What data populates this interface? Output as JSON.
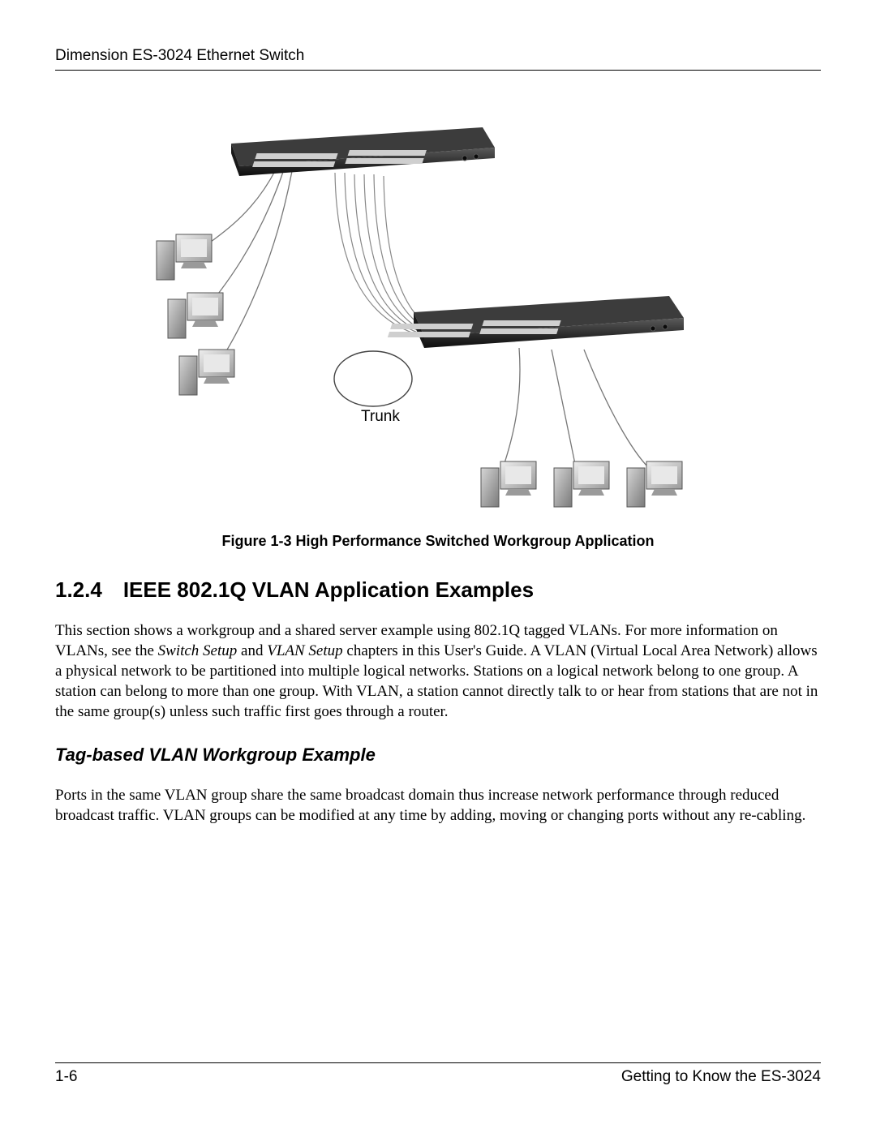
{
  "header": {
    "title": "Dimension ES-3024 Ethernet Switch"
  },
  "figure": {
    "trunk_label": "Trunk",
    "caption": "Figure 1-3 High Performance Switched Workgroup Application"
  },
  "section": {
    "number": "1.2.4",
    "title": "IEEE 802.1Q VLAN Application Examples"
  },
  "para1": {
    "pre": "This section shows a workgroup and a shared server example using 802.1Q tagged VLANs. For more information on VLANs, see the ",
    "ital1": "Switch Setup",
    "mid": " and ",
    "ital2": "VLAN Setup",
    "post": " chapters in this User's Guide. A VLAN (Virtual Local Area Network) allows a physical network to be partitioned into multiple logical networks. Stations on a logical network belong to one group. A station can belong to more than one group. With VLAN, a station cannot directly talk to or hear from stations that are not in the same group(s) unless such traffic first goes through a router."
  },
  "subheading": "Tag-based VLAN Workgroup Example",
  "para2": "Ports in the same VLAN group share the same broadcast domain thus increase network performance through reduced broadcast traffic. VLAN groups can be modified at any time by adding, moving or changing ports without any re-cabling.",
  "footer": {
    "page": "1-6",
    "chapter": "Getting to Know the ES-3024"
  }
}
